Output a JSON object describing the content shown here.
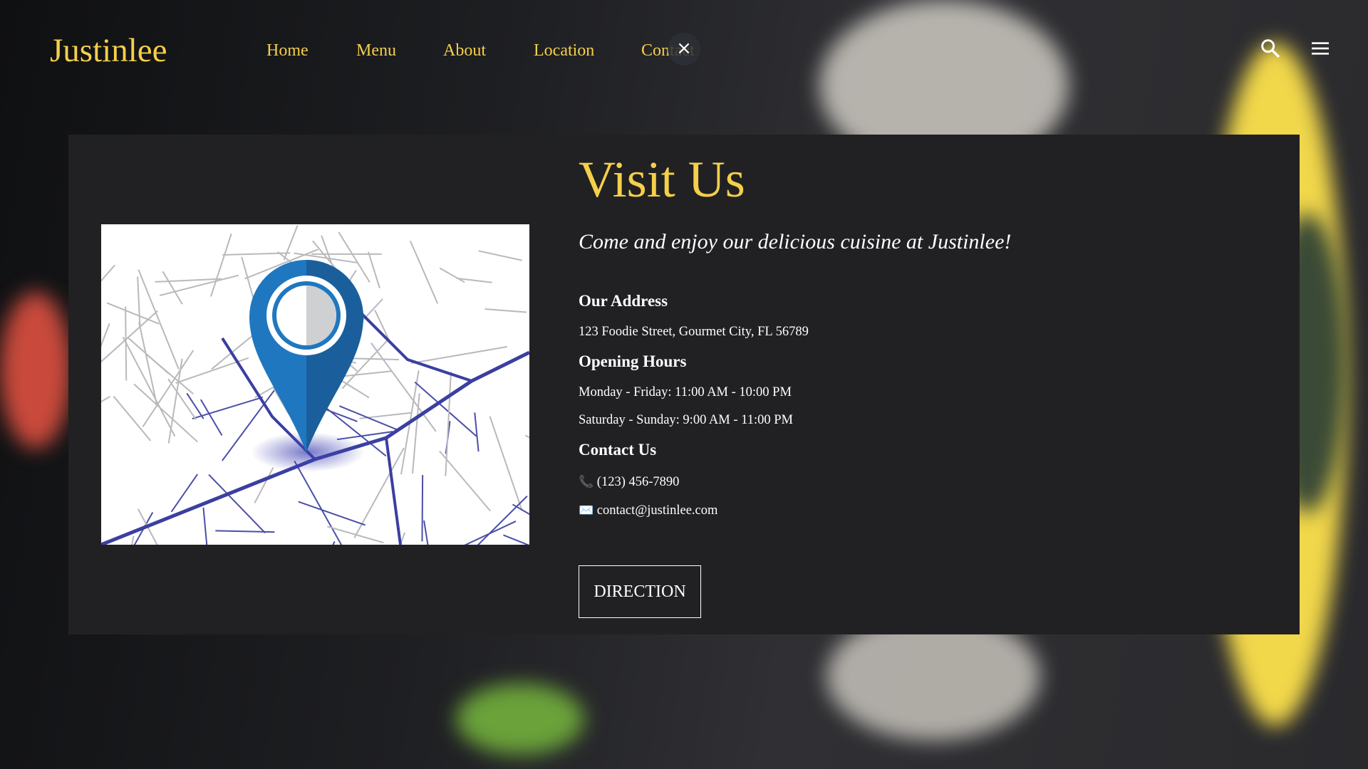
{
  "header": {
    "logo": "Justinlee",
    "nav": [
      "Home",
      "Menu",
      "About",
      "Location",
      "Contact"
    ],
    "close_label": "×"
  },
  "main": {
    "title": "Visit Us",
    "subtitle": "Come and enjoy our delicious cuisine at Justinlee!",
    "address_heading": "Our Address",
    "address": "123 Foodie Street, Gourmet City, FL 56789",
    "hours_heading": "Opening Hours",
    "hours": [
      "Monday - Friday: 11:00 AM - 10:00 PM",
      "Saturday - Sunday: 9:00 AM - 11:00 PM"
    ],
    "contact_heading": "Contact Us",
    "phone_icon": "📞",
    "phone": "(123) 456-7890",
    "email_icon": "✉️",
    "email": "contact@justinlee.com",
    "direction_label": "DIRECTION"
  },
  "colors": {
    "accent": "#f4cf4a",
    "card": "#212123"
  }
}
